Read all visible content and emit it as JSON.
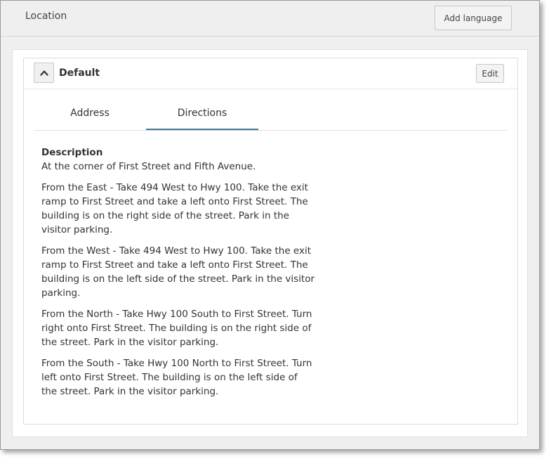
{
  "header": {
    "title": "Location",
    "add_language_label": "Add language"
  },
  "card": {
    "title": "Default",
    "edit_label": "Edit",
    "collapse_icon": "chevron-up-icon"
  },
  "tabs": [
    {
      "label": "Address",
      "active": false
    },
    {
      "label": "Directions",
      "active": true
    }
  ],
  "directions": {
    "label": "Description",
    "paragraphs": [
      "At the corner of First Street and Fifth Avenue.",
      "From the East - Take 494 West to Hwy 100. Take the exit ramp to First Street and take a left onto First Street. The building is on the right side of the street. Park in the visitor parking.",
      "From the West - Take 494 West to Hwy 100. Take the exit ramp to First Street and take a left onto First Street. The building is on the left side of the street. Park in the visitor parking.",
      "From the North - Take Hwy 100 South to First Street. Turn right onto First Street. The building is on the right side of the street. Park in the visitor parking.",
      "From the South - Take Hwy 100 North to First Street. Turn left onto First Street. The building is on the left side of the street. Park in the visitor parking."
    ]
  },
  "colors": {
    "active_tab_underline": "#2a7db0",
    "background": "#efefef"
  }
}
